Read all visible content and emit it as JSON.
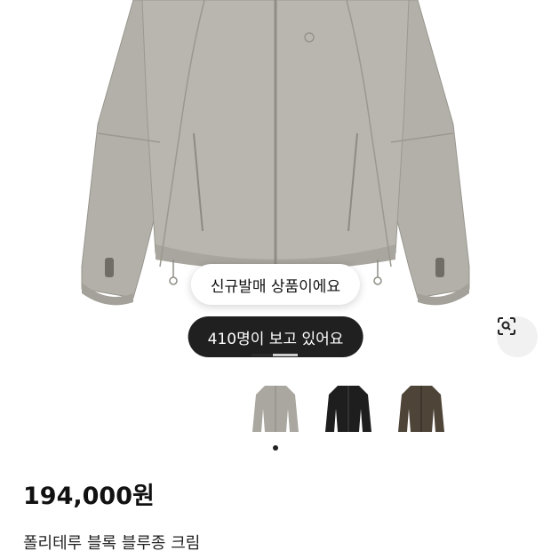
{
  "product": {
    "image_alt": "jacket-photo",
    "badge_new": "신규발매 상품이에요",
    "viewers_text": "410명이 보고 있어요",
    "carousel_progress": 0.46,
    "price": "194,000원",
    "name": "폴리테루 블록 블루종 크림"
  },
  "color_options": [
    {
      "name": "cream",
      "color": "#a9a79f",
      "selected": true
    },
    {
      "name": "black",
      "color": "#1e1e1e",
      "selected": false
    },
    {
      "name": "brown",
      "color": "#4e4438",
      "selected": false
    }
  ],
  "icons": {
    "lens": "image-search-icon"
  },
  "colors": {
    "jacket_main": "#b4b2aa",
    "jacket_shadow": "#9e9c94",
    "pill_dark": "#202020"
  }
}
